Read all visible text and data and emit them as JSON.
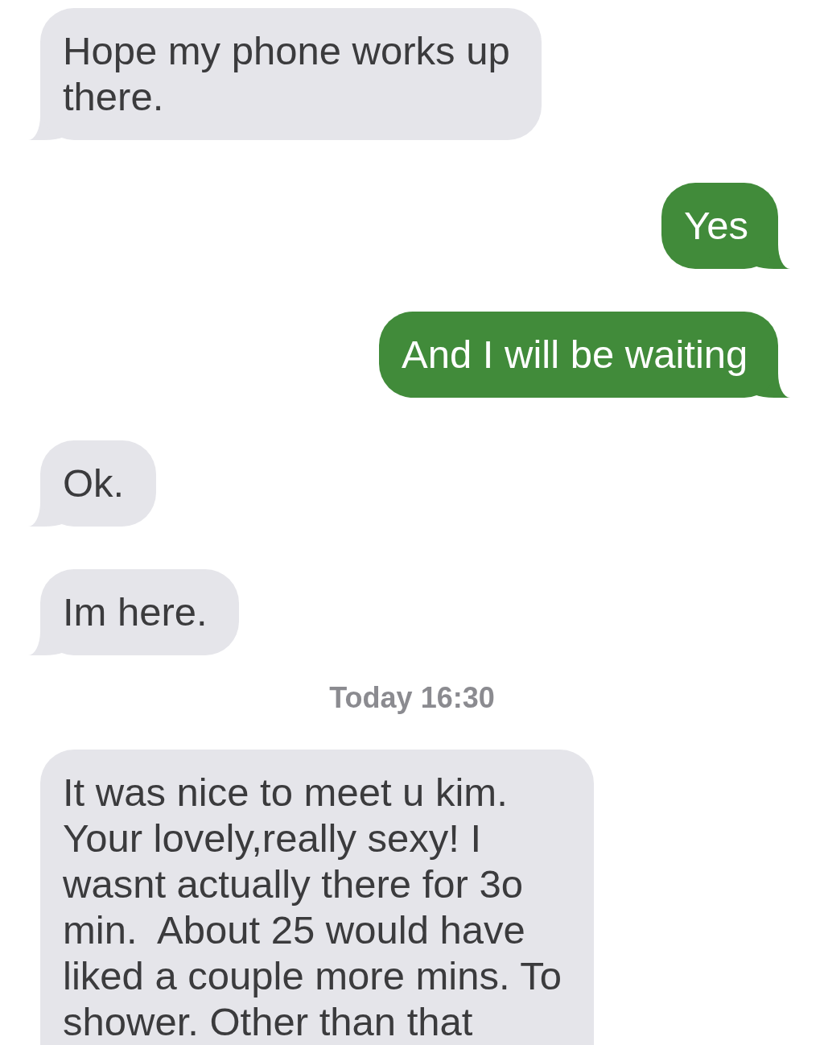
{
  "messages": [
    {
      "kind": "incoming",
      "text": "Hope my phone works up there.",
      "cut_off": false
    },
    {
      "kind": "outgoing",
      "text": "Yes",
      "cut_off": false
    },
    {
      "kind": "outgoing",
      "text": "And I will be waiting",
      "cut_off": false
    },
    {
      "kind": "incoming",
      "text": "Ok.",
      "cut_off": false
    },
    {
      "kind": "incoming",
      "text": "Im here.",
      "cut_off": false
    },
    {
      "kind": "timestamp",
      "text": "Today 16:30"
    },
    {
      "kind": "incoming",
      "text": "It was nice to meet u kim. Your lovely,really sexy! I wasnt actually there for 3o min.  About 25 would have liked a couple more mins. To shower. Other than that",
      "cut_off": true
    }
  ]
}
